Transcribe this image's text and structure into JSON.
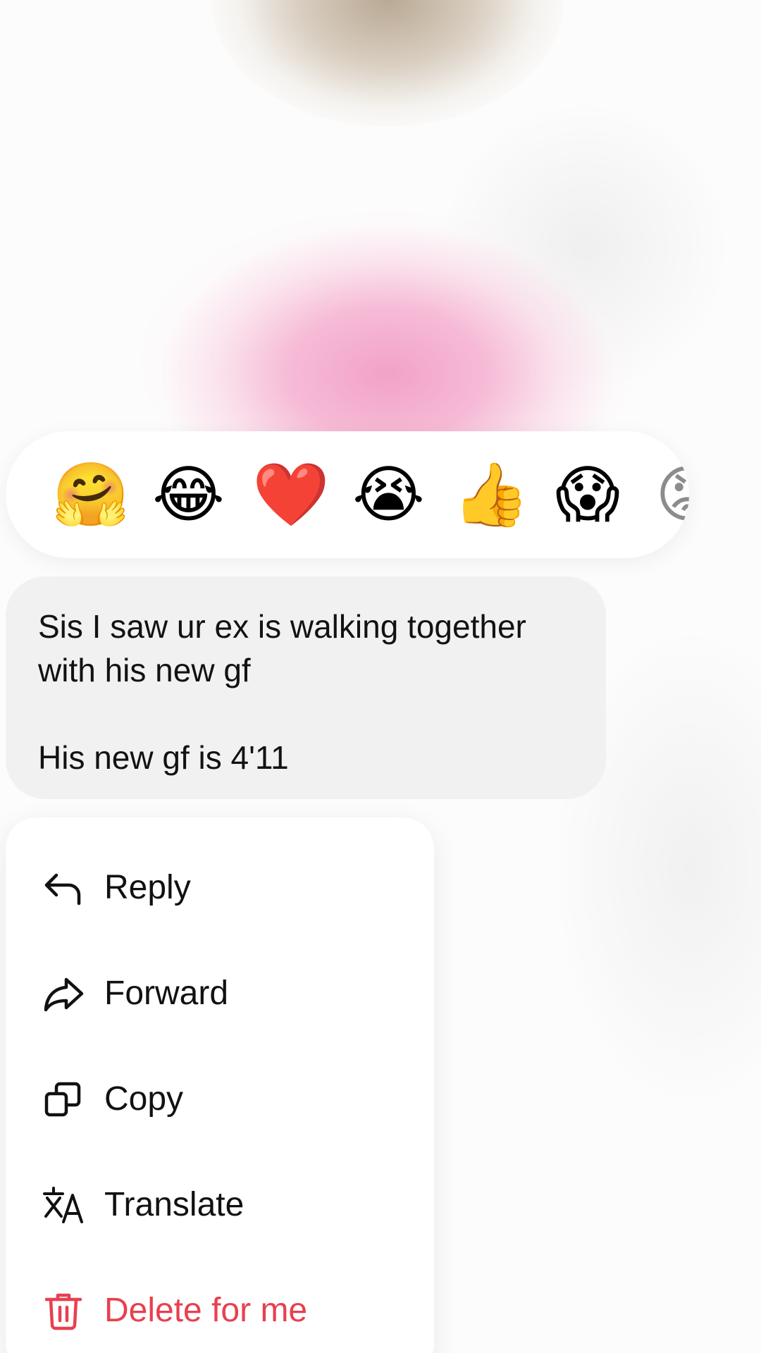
{
  "reactions": {
    "items": [
      {
        "emoji": "🤗",
        "name": "hugging-face-emoji"
      },
      {
        "emoji": "😂",
        "name": "tears-of-joy-emoji"
      },
      {
        "emoji": "❤️",
        "name": "red-heart-emoji"
      },
      {
        "emoji": "😭",
        "name": "loudly-crying-emoji"
      },
      {
        "emoji": "👍",
        "name": "thumbs-up-emoji"
      },
      {
        "emoji": "😱",
        "name": "screaming-emoji"
      },
      {
        "emoji": "😡",
        "name": "angry-face-emoji"
      }
    ]
  },
  "message": {
    "line1": "Sis I saw ur ex is walking together with his new gf",
    "line2": "His new gf is 4'11"
  },
  "menu": {
    "reply": "Reply",
    "forward": "Forward",
    "copy": "Copy",
    "translate": "Translate",
    "delete": "Delete for me"
  },
  "colors": {
    "danger": "#e8404f",
    "bubble": "#f1f1f2",
    "text": "#111111"
  },
  "icons": {
    "reply": "reply-arrow-icon",
    "forward": "forward-arrow-icon",
    "copy": "copy-icon",
    "translate": "translate-icon",
    "delete": "trash-icon"
  }
}
